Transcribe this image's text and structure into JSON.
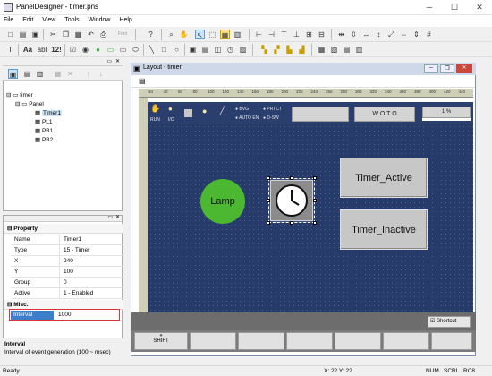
{
  "window": {
    "title": "PanelDesigner - timer.pns",
    "minimize": "─",
    "maximize": "☐",
    "close": "✕"
  },
  "menu": [
    "File",
    "Edit",
    "View",
    "Tools",
    "Window",
    "Help"
  ],
  "toolbar": {
    "font_label": "Font",
    "text_a_label": "Aa",
    "bold_label": "abl",
    "num_label": "12!"
  },
  "tree": {
    "root": "timer",
    "panel": "Panel",
    "items": [
      "Timer1",
      "PL1",
      "PB1",
      "PB2"
    ],
    "selected": "Timer1"
  },
  "properties": {
    "section_property": "Property",
    "rows": [
      {
        "key": "Name",
        "value": "Timer1"
      },
      {
        "key": "Type",
        "value": "15 - Timer"
      },
      {
        "key": "X",
        "value": "240"
      },
      {
        "key": "Y",
        "value": "100"
      },
      {
        "key": "Group",
        "value": "0"
      },
      {
        "key": "Active",
        "value": "1 - Enabled"
      }
    ],
    "section_misc": "Misc.",
    "interval_key": "Interval",
    "interval_value": "1000"
  },
  "help": {
    "title": "Interval",
    "text": "Interval of event generation (100 ~ msec)"
  },
  "layout_window": {
    "title": "Layout - timer",
    "ruler_marks": [
      "20",
      "40",
      "60",
      "80",
      "100",
      "120",
      "140",
      "160",
      "180",
      "200",
      "220",
      "240",
      "260",
      "280",
      "300",
      "320",
      "340",
      "360",
      "380",
      "400",
      "420",
      "440"
    ]
  },
  "top_strip": {
    "run_label": "RUN",
    "io_label": "I/O",
    "bvg": "BVG",
    "prtct": "PRTCT",
    "auto_en": "AUTO EN",
    "d_sw": "D-SW",
    "woto": "W O T O",
    "percent": "1  %"
  },
  "canvas": {
    "lamp_label": "Lamp",
    "active_label": "Timer_Active",
    "inactive_label": "Timer_Inactive",
    "shortcut_label": "Shortcut",
    "shift_label": "SHIFT"
  },
  "status": {
    "left": "Ready",
    "coords": "X:  22   Y:  22",
    "num": "NUM",
    "scrl": "SCRL",
    "rc": "RC8"
  },
  "colors": {
    "canvas_bg": "#273b6b",
    "lamp_green": "#4cb731",
    "selection": "#cce4f7",
    "interval_highlight": "#3d7ecc",
    "interval_border": "#d9343a"
  }
}
